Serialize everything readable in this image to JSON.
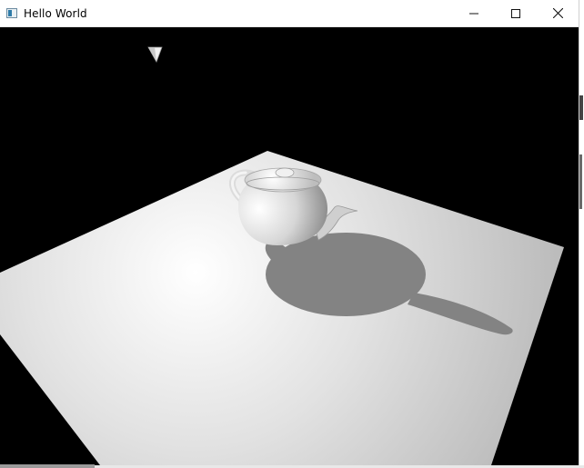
{
  "window": {
    "title": "Hello World",
    "icon": "app-window-icon"
  },
  "controls": {
    "minimize": "minimize-icon",
    "maximize": "maximize-icon",
    "close": "close-icon"
  },
  "scene": {
    "background_color": "#000000",
    "floor_color": "#d4d4d4",
    "shadow_color": "#828282",
    "object": "teapot"
  }
}
